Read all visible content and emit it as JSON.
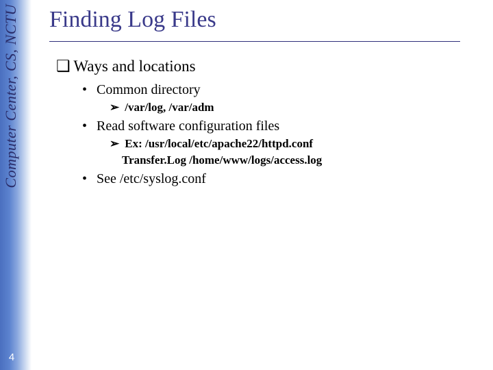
{
  "side_label": "Computer Center, CS, NCTU",
  "page_number": "4",
  "title": "Finding Log Files",
  "bullets": {
    "main": "Ways and locations",
    "b1": "Common directory",
    "b1_1": "/var/log, /var/adm",
    "b2": "Read software configuration files",
    "b2_1": "Ex: /usr/local/etc/apache22/httpd.conf",
    "b2_1_cont": "Transfer.Log /home/www/logs/access.log",
    "b3": "See /etc/syslog.conf"
  },
  "markers": {
    "square": "❑",
    "dot": "•",
    "tri": "➢"
  }
}
